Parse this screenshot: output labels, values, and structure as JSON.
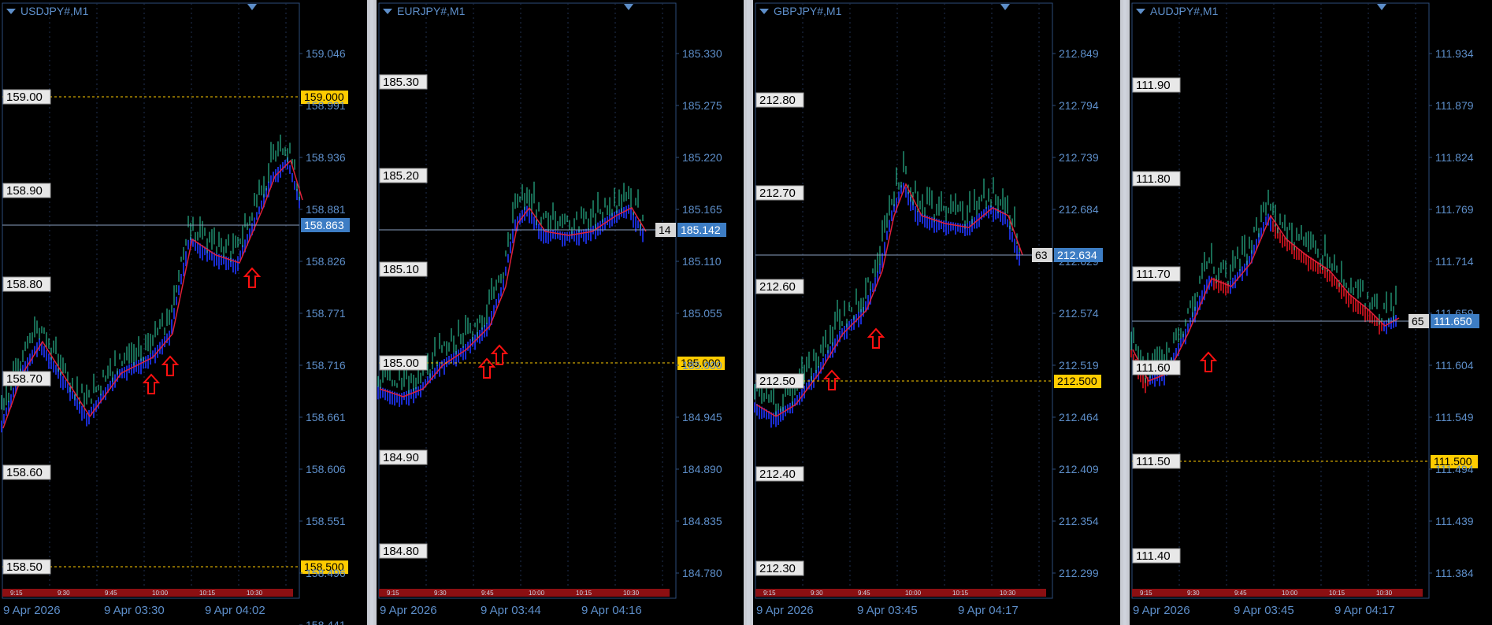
{
  "panels": [
    {
      "id": "usdjpy",
      "title": "USDJPY#,M1",
      "axis_ticks": [
        "159.046",
        "158.991",
        "158.936",
        "158.881",
        "158.826",
        "158.771",
        "158.716",
        "158.661",
        "158.606",
        "158.551",
        "158.496",
        "158.441"
      ],
      "level_labels": [
        "159.00",
        "158.90",
        "158.80",
        "158.70",
        "158.60",
        "158.50"
      ],
      "hline_prices": [
        {
          "label": "159.000",
          "color": "#ffcc00",
          "kind": "level"
        },
        {
          "label": "158.500",
          "color": "#ffcc00",
          "kind": "level"
        }
      ],
      "bid_tag": "158.863",
      "bid_tag_left": "",
      "time_ticks": [
        "9:15",
        "9:30",
        "9:45",
        "10:00",
        "10:15",
        "10:30"
      ],
      "date_labels": [
        "9 Apr 2026",
        "9 Apr 03:30",
        "9 Apr 04:02"
      ]
    },
    {
      "id": "eurjpy",
      "title": "EURJPY#,M1",
      "axis_ticks": [
        "185.330",
        "185.275",
        "185.220",
        "185.165",
        "185.110",
        "185.055",
        "185.000",
        "184.945",
        "184.890",
        "184.835",
        "184.780"
      ],
      "level_labels": [
        "185.30",
        "185.20",
        "185.10",
        "185.00",
        "184.90",
        "184.80"
      ],
      "hline_prices": [
        {
          "label": "185.000",
          "color": "#ffcc00",
          "kind": "level"
        }
      ],
      "bid_tag": "185.142",
      "bid_tag_left": "14",
      "time_ticks": [
        "9:15",
        "9:30",
        "9:45",
        "10:00",
        "10:15",
        "10:30"
      ],
      "date_labels": [
        "9 Apr 2026",
        "9 Apr 03:44",
        "9 Apr 04:16"
      ]
    },
    {
      "id": "gbpjpy",
      "title": "GBPJPY#,M1",
      "axis_ticks": [
        "212.849",
        "212.794",
        "212.739",
        "212.684",
        "212.629",
        "212.574",
        "212.519",
        "212.464",
        "212.409",
        "212.354",
        "212.299"
      ],
      "level_labels": [
        "212.80",
        "212.70",
        "212.60",
        "212.50",
        "212.40",
        "212.30"
      ],
      "hline_prices": [
        {
          "label": "212.500",
          "color": "#ffcc00",
          "kind": "level"
        }
      ],
      "bid_tag": "212.634",
      "bid_tag_left": "63",
      "time_ticks": [
        "9:15",
        "9:30",
        "9:45",
        "10:00",
        "10:15",
        "10:30"
      ],
      "date_labels": [
        "9 Apr 2026",
        "9 Apr 03:45",
        "9 Apr 04:17"
      ]
    },
    {
      "id": "audjpy",
      "title": "AUDJPY#,M1",
      "axis_ticks": [
        "111.934",
        "111.879",
        "111.824",
        "111.769",
        "111.714",
        "111.659",
        "111.604",
        "111.549",
        "111.494",
        "111.439",
        "111.384"
      ],
      "level_labels": [
        "111.90",
        "111.80",
        "111.70",
        "111.60",
        "111.50",
        "111.40"
      ],
      "hline_prices": [
        {
          "label": "111.500",
          "color": "#ffcc00",
          "kind": "level"
        }
      ],
      "bid_tag": "111.650",
      "bid_tag_left": "65",
      "time_ticks": [
        "9:15",
        "9:30",
        "9:45",
        "10:00",
        "10:15",
        "10:30"
      ],
      "date_labels": [
        "9 Apr 2026",
        "9 Apr 03:45",
        "9 Apr 04:17"
      ]
    }
  ],
  "colors": {
    "candle": "#2fd6a8",
    "ribbon_up": "#1a2ccf",
    "ribbon_down": "#b0101a",
    "fast_ma": "#e0203a",
    "grid": "#2d4d7a",
    "axis_text": "#5d8ec9",
    "bid_line": "#8aa0c0",
    "bid_tag_bg": "#3d7dc4",
    "level_line": "#ffcc00",
    "arrow": "#ff1010",
    "time_bar": "#8b0f12"
  }
}
